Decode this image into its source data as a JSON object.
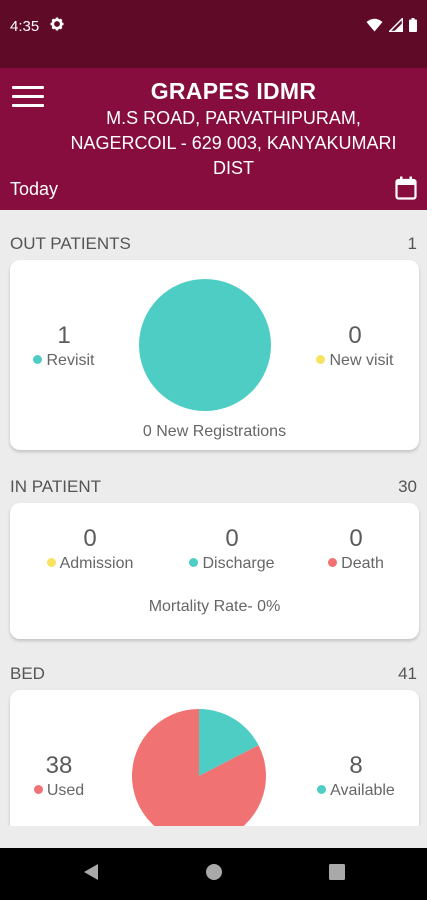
{
  "statusbar": {
    "time": "4:35"
  },
  "header": {
    "title": "GRAPES IDMR",
    "address_line1": "M.S ROAD, PARVATHIPURAM,",
    "address_line2": "NAGERCOIL - 629 003, KANYAKUMARI",
    "address_line3": "DIST",
    "date_filter": "Today"
  },
  "outpatients": {
    "heading": "OUT PATIENTS",
    "total": "1",
    "revisit_count": "1",
    "revisit_label": "Revisit",
    "newvisit_count": "0",
    "newvisit_label": "New visit",
    "registrations": "0 New Registrations"
  },
  "inpatient": {
    "heading": "IN PATIENT",
    "total": "30",
    "admission_count": "0",
    "admission_label": "Admission",
    "discharge_count": "0",
    "discharge_label": "Discharge",
    "death_count": "0",
    "death_label": "Death",
    "mortality": "Mortality Rate- 0%"
  },
  "bed": {
    "heading": "BED",
    "total": "41",
    "used_count": "38",
    "used_label": "Used",
    "available_count": "8",
    "available_label": "Available"
  },
  "colors": {
    "teal": "#4ecdc4",
    "yellow": "#f7e35d",
    "red": "#f07272",
    "header": "#860d3d",
    "statusbar": "#5f0a26"
  },
  "icons": {
    "menu": "hamburger-menu-icon",
    "calendar": "calendar-icon",
    "settings": "gear-icon",
    "nav_back": "back-triangle-icon",
    "nav_home": "home-circle-icon",
    "nav_recents": "recents-square-icon"
  }
}
